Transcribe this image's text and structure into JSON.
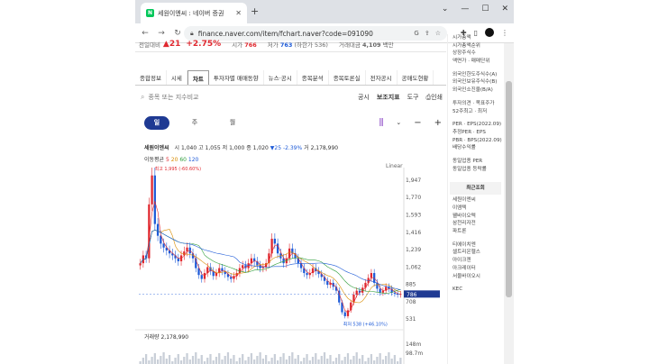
{
  "browser": {
    "tab_title": "세원이엔씨 : 네이버 증권",
    "tab_icon": "N",
    "url": "finance.naver.com/item/fchart.naver?code=091090"
  },
  "ticker": {
    "label": "전일대비",
    "change_abs": "▲21",
    "change_pct": "+2.75%",
    "items": [
      {
        "label": "시가",
        "value": "766",
        "color": "#e0282f",
        "note": ""
      },
      {
        "label": "저가",
        "value": "763",
        "color": "#1e5bd8",
        "note": "(하한가 536)"
      },
      {
        "label": "거래대금",
        "value": "4,109",
        "color": "#333333",
        "note": "백만"
      }
    ]
  },
  "main_tabs": [
    {
      "label": "종합정보",
      "active": false
    },
    {
      "label": "시세",
      "active": false
    },
    {
      "label": "차트",
      "active": true
    },
    {
      "label": "투자자별 매매동향",
      "active": false
    },
    {
      "label": "뉴스·공시",
      "active": false
    },
    {
      "label": "종목분석",
      "active": false
    },
    {
      "label": "종목토론실",
      "active": false
    },
    {
      "label": "전자공시",
      "active": false
    },
    {
      "label": "공매도현황",
      "active": false
    }
  ],
  "search": {
    "placeholder": "종목 또는 지수비교",
    "links": [
      "공시",
      "보조지표",
      "도구",
      "인쇄"
    ]
  },
  "periods": [
    {
      "label": "일",
      "active": true
    },
    {
      "label": "주",
      "active": false
    },
    {
      "label": "월",
      "active": false
    }
  ],
  "chart_info": {
    "name": "세원이엔씨",
    "open_label": "시",
    "open": "1,040",
    "high_label": "고",
    "high": "1,055",
    "low_label": "저",
    "low": "1,000",
    "close_label": "종",
    "close": "1,020",
    "change": "▼25",
    "change_pct": "-2.39%",
    "volume_label": "거",
    "volume": "2,178,990",
    "ma_label": "이동평균",
    "ma": [
      "5",
      "20",
      "60",
      "120"
    ],
    "scale_label": "Linear"
  },
  "volume_info": {
    "label": "거래량",
    "value": "2,178,990"
  },
  "chart_data": {
    "type": "candlestick",
    "y_ticks": [
      "1,947",
      "1,770",
      "1,593",
      "1,416",
      "1,239",
      "1,062",
      "885",
      "708",
      "531"
    ],
    "ylim": [
      440,
      2020
    ],
    "last_price": "786",
    "max_label": "최고 1,995 (-60.60%)",
    "min_label": "최저 538 (+46.10%)",
    "volume_ticks": [
      "148m",
      "98.7m"
    ],
    "closes": [
      1100,
      1180,
      1150,
      1700,
      1995,
      1500,
      1380,
      1300,
      1260,
      1230,
      1200,
      1180,
      1150,
      1120,
      1180,
      1220,
      1260,
      1200,
      1150,
      1050,
      980,
      940,
      1000,
      1060,
      1020,
      970,
      1000,
      1050,
      1020,
      990,
      960,
      940,
      970,
      1000,
      1050,
      1080,
      1050,
      1100,
      1150,
      1120,
      1080,
      1050,
      1060,
      1100,
      1200,
      1350,
      1300,
      1200,
      1150,
      1100,
      1150,
      1250,
      1200,
      1150,
      1100,
      1050,
      1000,
      980,
      1000,
      1050,
      1020,
      990,
      960,
      920,
      880,
      900,
      860,
      820,
      700,
      600,
      560,
      620,
      700,
      780,
      820,
      800,
      850,
      900,
      950,
      1000,
      900,
      840,
      800,
      820,
      860,
      840,
      800,
      790,
      780,
      786
    ],
    "ma_series": [
      {
        "name": "5",
        "color": "#e0282f"
      },
      {
        "name": "20",
        "color": "#d98c00"
      },
      {
        "name": "60",
        "color": "#2e9d3a"
      },
      {
        "name": "120",
        "color": "#1e5bd8"
      }
    ]
  },
  "sidebar": {
    "group1": [
      "시가총액",
      "시가총액순위",
      "상장주식수",
      "액면가 · 매매단위"
    ],
    "group2": [
      "외국인한도주식수(A)",
      "외국인보유주식수(B)",
      "외국인소진율(B/A)"
    ],
    "group3": [
      "투자의견 · 목표주가",
      "52주최고 · 최저"
    ],
    "group4": [
      "PER · EPS(2022.09)",
      "추정PER · EPS",
      "PBR · BPS(2022.09)",
      "배당수익률"
    ],
    "group5": [
      "동일업종 PER",
      "동일업종 등락률"
    ],
    "recent_title": "최근조회",
    "recent": [
      "세원이엔씨",
      "이엠텍",
      "웰바이오텍",
      "삼천리자전",
      "파트론",
      "",
      "티에이치엔",
      "셀트리온헬스",
      "아이크젠",
      "아크레이터",
      "서울바이오시",
      "",
      "KEC"
    ]
  }
}
